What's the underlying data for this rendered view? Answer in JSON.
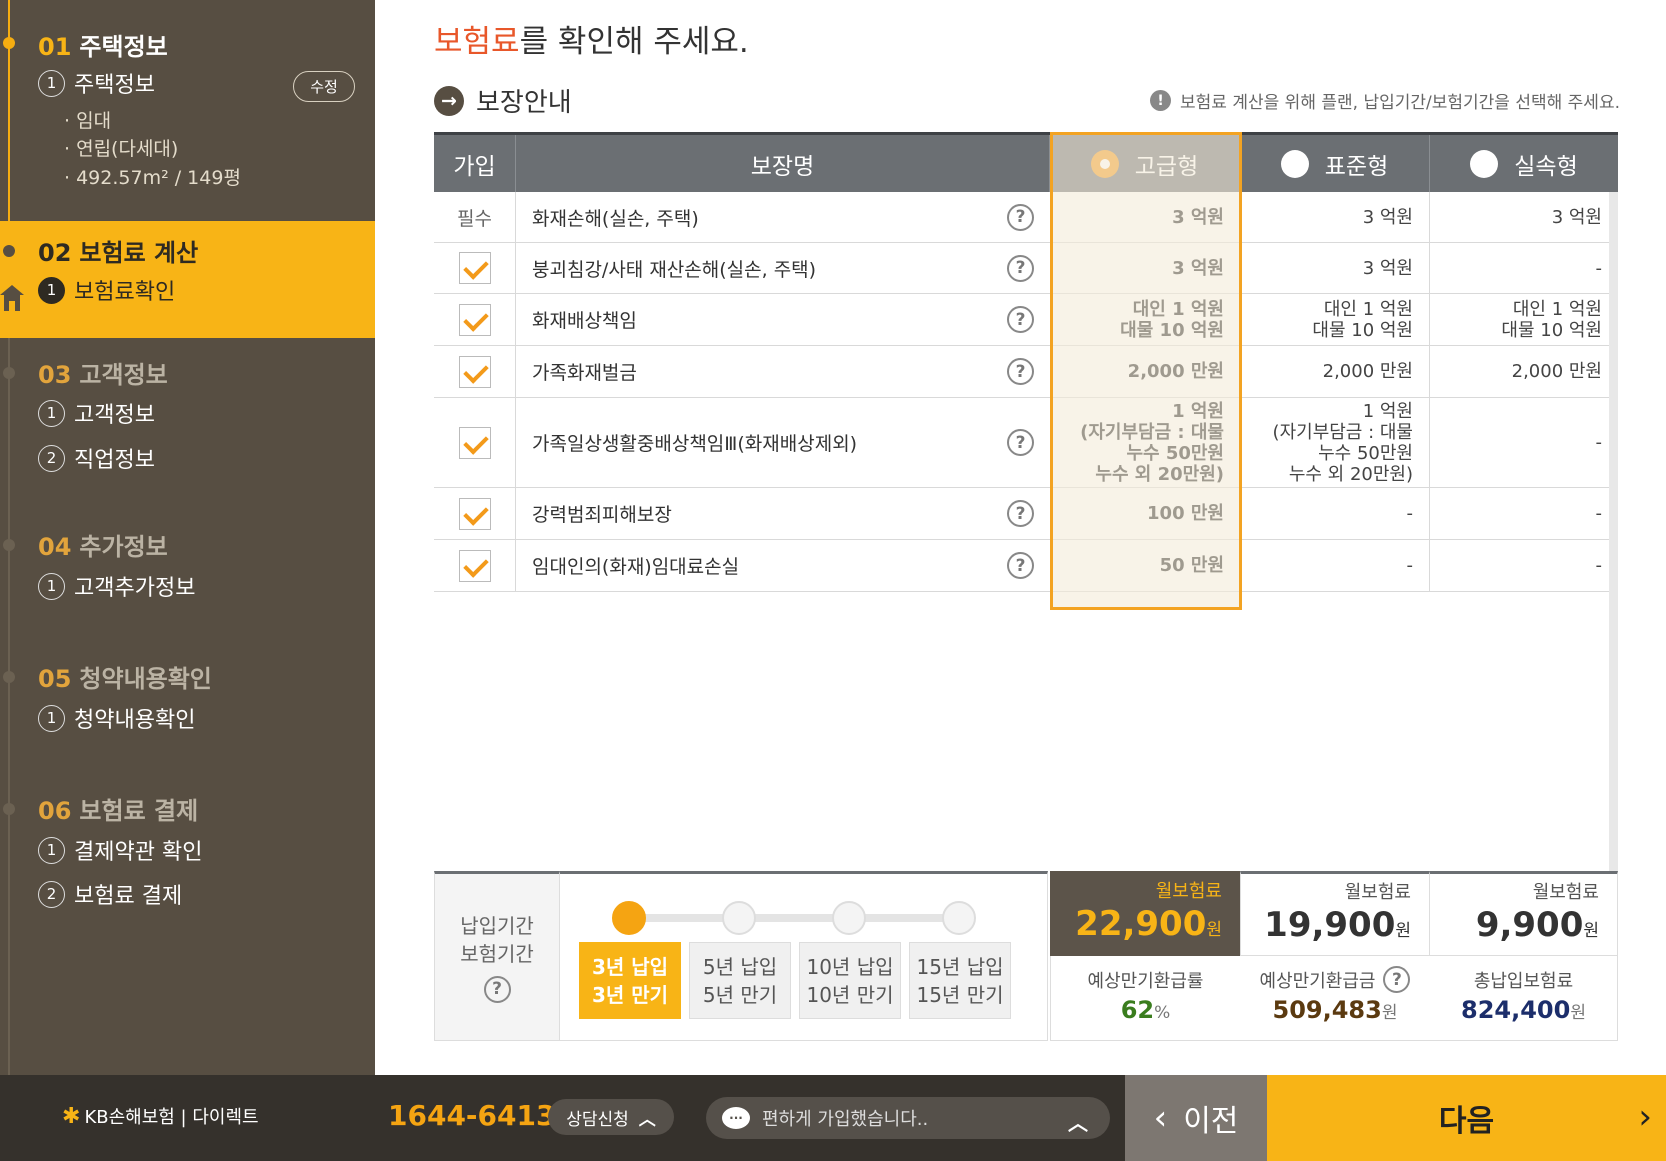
{
  "sidebar": {
    "edit_label": "수정",
    "steps": [
      {
        "num": "01",
        "title": "주택정보",
        "subs": [
          {
            "n": "1",
            "label": "주택정보"
          }
        ],
        "details": [
          "임대",
          "연립(다세대)",
          "492.57m² / 149평"
        ]
      },
      {
        "num": "02",
        "title": "보험료 계산",
        "subs": [
          {
            "n": "1",
            "label": "보험료확인"
          }
        ]
      },
      {
        "num": "03",
        "title": "고객정보",
        "subs": [
          {
            "n": "1",
            "label": "고객정보"
          },
          {
            "n": "2",
            "label": "직업정보"
          }
        ]
      },
      {
        "num": "04",
        "title": "추가정보",
        "subs": [
          {
            "n": "1",
            "label": "고객추가정보"
          }
        ]
      },
      {
        "num": "05",
        "title": "청약내용확인",
        "subs": [
          {
            "n": "1",
            "label": "청약내용확인"
          }
        ]
      },
      {
        "num": "06",
        "title": "보험료 결제",
        "subs": [
          {
            "n": "1",
            "label": "결제약관 확인"
          },
          {
            "n": "2",
            "label": "보험료 결제"
          }
        ]
      }
    ]
  },
  "main": {
    "title_highlight": "보험료",
    "title_rest": "를 확인해 주세요.",
    "section_title": "보장안내",
    "notice": "보험료 계산을 위해 플랜, 납입기간/보험기간을 선택해 주세요."
  },
  "table": {
    "headers": {
      "join": "가입",
      "name": "보장명"
    },
    "plans": [
      "고급형",
      "표준형",
      "실속형"
    ],
    "selected_plan": 0,
    "rows": [
      {
        "join": "필수",
        "checked": false,
        "name": "화재손해(실손, 주택)",
        "p1": "3 억원",
        "p2": "3 억원",
        "p3": "3 억원"
      },
      {
        "join": "",
        "checked": true,
        "name": "붕괴침강/사태 재산손해(실손, 주택)",
        "p1": "3 억원",
        "p2": "3 억원",
        "p3": "-"
      },
      {
        "join": "",
        "checked": true,
        "name": "화재배상책임",
        "p1": "대인 1 억원\n대물 10 억원",
        "p2": "대인 1 억원\n대물 10 억원",
        "p3": "대인 1 억원\n대물 10 억원"
      },
      {
        "join": "",
        "checked": true,
        "name": "가족화재벌금",
        "p1": "2,000 만원",
        "p2": "2,000 만원",
        "p3": "2,000 만원"
      },
      {
        "join": "",
        "checked": true,
        "name": "가족일상생활중배상책임Ⅲ(화재배상제외)",
        "p1": "1 억원\n(자기부담금 : 대물\n누수 50만원\n누수 외 20만원)",
        "p2": "1 억원\n(자기부담금 : 대물\n누수 50만원\n누수 외 20만원)",
        "p3": "-"
      },
      {
        "join": "",
        "checked": true,
        "name": "강력범죄피해보장",
        "p1": "100 만원",
        "p2": "-",
        "p3": "-"
      },
      {
        "join": "",
        "checked": true,
        "name": "임대인의(화재)임대료손실",
        "p1": "50 만원",
        "p2": "-",
        "p3": "-"
      }
    ]
  },
  "periods": {
    "label_1": "납입기간",
    "label_2": "보험기간",
    "selected": 0,
    "options": [
      {
        "pay": "3년 납입",
        "term": "3년 만기"
      },
      {
        "pay": "5년 납입",
        "term": "5년 만기"
      },
      {
        "pay": "10년 납입",
        "term": "10년 만기"
      },
      {
        "pay": "15년 납입",
        "term": "15년 만기"
      }
    ]
  },
  "premium": {
    "label": "월보험료",
    "unit": "원",
    "values": [
      "22,900",
      "19,900",
      "9,900"
    ],
    "stats": [
      {
        "label": "예상만기환급률",
        "value": "62",
        "unit": "%",
        "color": "#3a7d1e"
      },
      {
        "label": "예상만기환급금",
        "value": "509,483",
        "unit": "원",
        "color": "#5b3a10"
      },
      {
        "label": "총납입보험료",
        "value": "824,400",
        "unit": "원",
        "color": "#1c2e6b"
      }
    ]
  },
  "footer": {
    "brand": "KB손해보험 | 다이렉트",
    "phone": "1644-6413",
    "consult": "상담신청",
    "chat": "편하게 가입했습니다..",
    "prev": "이전",
    "next": "다음"
  },
  "colors": {
    "accent": "#f8b416",
    "highlight": "#e8572a",
    "sidebar": "#574e42"
  }
}
